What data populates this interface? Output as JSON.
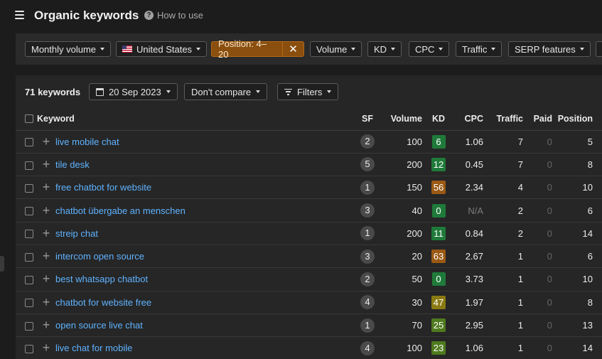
{
  "header": {
    "title": "Organic keywords",
    "how_to_use": "How to use"
  },
  "filters": {
    "monthly_volume": "Monthly volume",
    "country": "United States",
    "position": "Position: 4–20",
    "volume": "Volume",
    "kd": "KD",
    "cpc": "CPC",
    "traffic": "Traffic",
    "serp_features": "SERP features"
  },
  "toolbar": {
    "count": "71 keywords",
    "date": "20 Sep 2023",
    "compare": "Don't compare",
    "filters": "Filters"
  },
  "table": {
    "headers": {
      "keyword": "Keyword",
      "sf": "SF",
      "volume": "Volume",
      "kd": "KD",
      "cpc": "CPC",
      "traffic": "Traffic",
      "paid": "Paid",
      "position": "Position"
    },
    "rows": [
      {
        "keyword": "live mobile chat",
        "sf": "2",
        "volume": "100",
        "kd": "6",
        "kd_color": "#1f7a3a",
        "cpc": "1.06",
        "traffic": "7",
        "paid": "0",
        "position": "5"
      },
      {
        "keyword": "tile desk",
        "sf": "5",
        "volume": "200",
        "kd": "12",
        "kd_color": "#1f7a3a",
        "cpc": "0.45",
        "traffic": "7",
        "paid": "0",
        "position": "8"
      },
      {
        "keyword": "free chatbot for website",
        "sf": "1",
        "volume": "150",
        "kd": "56",
        "kd_color": "#9a5a14",
        "cpc": "2.34",
        "traffic": "4",
        "paid": "0",
        "position": "10"
      },
      {
        "keyword": "chatbot übergabe an menschen",
        "sf": "3",
        "volume": "40",
        "kd": "0",
        "kd_color": "#1f7a3a",
        "cpc": "N/A",
        "traffic": "2",
        "paid": "0",
        "position": "6"
      },
      {
        "keyword": "streip chat",
        "sf": "1",
        "volume": "200",
        "kd": "11",
        "kd_color": "#1f7a3a",
        "cpc": "0.84",
        "traffic": "2",
        "paid": "0",
        "position": "14"
      },
      {
        "keyword": "intercom open source",
        "sf": "3",
        "volume": "20",
        "kd": "63",
        "kd_color": "#9a5a14",
        "cpc": "2.67",
        "traffic": "1",
        "paid": "0",
        "position": "6"
      },
      {
        "keyword": "best whatsapp chatbot",
        "sf": "2",
        "volume": "50",
        "kd": "0",
        "kd_color": "#1f7a3a",
        "cpc": "3.73",
        "traffic": "1",
        "paid": "0",
        "position": "10"
      },
      {
        "keyword": "chatbot for website free",
        "sf": "4",
        "volume": "30",
        "kd": "47",
        "kd_color": "#8a7a12",
        "cpc": "1.97",
        "traffic": "1",
        "paid": "0",
        "position": "8"
      },
      {
        "keyword": "open source live chat",
        "sf": "1",
        "volume": "70",
        "kd": "25",
        "kd_color": "#4f7a1e",
        "cpc": "2.95",
        "traffic": "1",
        "paid": "0",
        "position": "13"
      },
      {
        "keyword": "live chat for mobile",
        "sf": "4",
        "volume": "100",
        "kd": "23",
        "kd_color": "#4f7a1e",
        "cpc": "1.06",
        "traffic": "1",
        "paid": "0",
        "position": "14"
      }
    ]
  }
}
